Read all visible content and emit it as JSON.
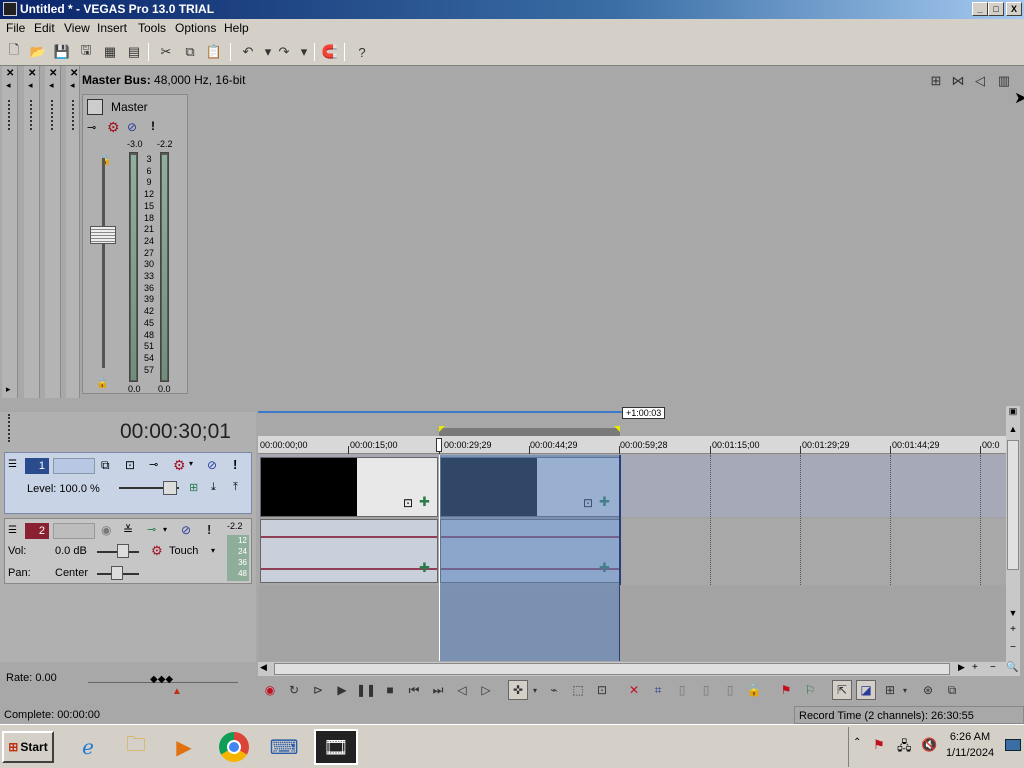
{
  "window": {
    "title": "Untitled * - VEGAS Pro 13.0 TRIAL",
    "buttons": [
      "_",
      "□",
      "X"
    ]
  },
  "menu": [
    "File",
    "Edit",
    "View",
    "Insert",
    "Tools",
    "Options",
    "Help"
  ],
  "toolbar_icons": [
    "new-icon",
    "open-icon",
    "save-icon",
    "save-as-icon",
    "render-icon",
    "properties-icon",
    "cut-icon",
    "copy-icon",
    "paste-icon",
    "undo-icon",
    "redo-icon",
    "enable-snapping-icon",
    "whats-this-icon"
  ],
  "mixer": {
    "bus_label": "Master Bus:",
    "bus_info": "48,000 Hz, 16-bit",
    "master_name": "Master",
    "peak_left": "-3.0",
    "peak_right": "-2.2",
    "scale": [
      "3",
      "6",
      "9",
      "12",
      "15",
      "18",
      "21",
      "24",
      "27",
      "30",
      "33",
      "36",
      "39",
      "42",
      "45",
      "48",
      "51",
      "54",
      "57"
    ],
    "bottom_left": "0.0",
    "bottom_right": "0.0"
  },
  "timeline": {
    "cursor_time": "00:00:30;01",
    "loop_length": "+1:00:03",
    "ruler": [
      "00:00:00;00",
      "00:00:15;00",
      "00:00:29;29",
      "00:00:44;29",
      "00:00:59;28",
      "00:01:15;00",
      "00:01:29;29",
      "00:01:44;29",
      "00:0"
    ]
  },
  "track1": {
    "number": "1",
    "level_label": "Level: 100.0 %"
  },
  "track2": {
    "number": "2",
    "peak": "-2.2",
    "vol_label": "Vol:",
    "vol_value": "0.0 dB",
    "pan_label": "Pan:",
    "pan_value": "Center",
    "automation": "Touch",
    "meter_scale": [
      "12",
      "24",
      "36",
      "48"
    ]
  },
  "rate": {
    "label": "Rate: 0.00"
  },
  "status": {
    "left": "Complete: 00:00:00",
    "right": "Record Time (2 channels): 26:30:55"
  },
  "taskbar": {
    "start": "Start",
    "time": "6:26 AM",
    "date": "1/11/2024"
  },
  "colors": {
    "title_start": "#0a246a",
    "selection": "#5a82be",
    "waveform": "#8e3e55"
  }
}
